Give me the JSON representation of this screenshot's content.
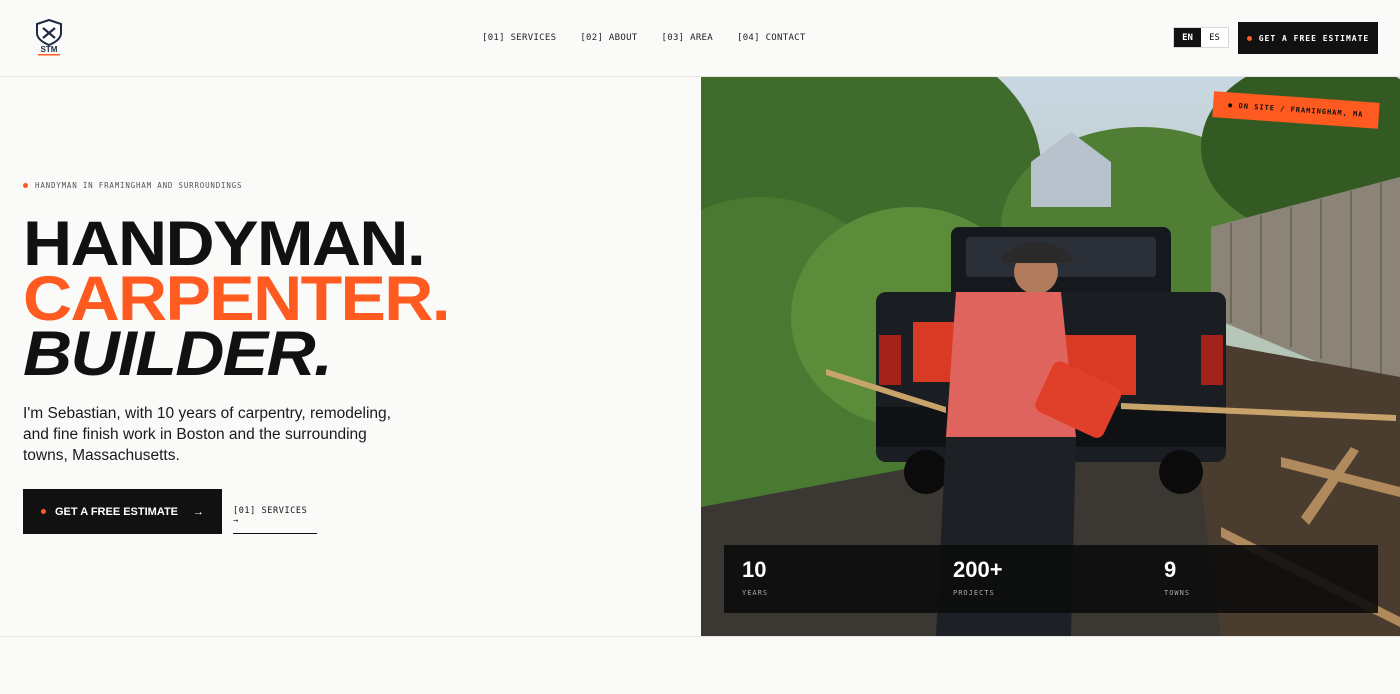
{
  "header": {
    "logo_text": "STM",
    "nav": [
      "[01] SERVICES",
      "[02] ABOUT",
      "[03] AREA",
      "[04] CONTACT"
    ],
    "lang_active": "EN",
    "lang_inactive": "ES",
    "cta_label": "GET A FREE ESTIMATE"
  },
  "hero": {
    "eyebrow": "HANDYMAN IN FRAMINGHAM AND SURROUNDINGS",
    "headline_1": "HANDYMAN.",
    "headline_2": "CARPENTER.",
    "headline_3": "BUILDER.",
    "lead": "I'm Sebastian, with 10 years of carpentry, remodeling, and fine finish work in Boston and the surrounding towns, Massachusetts.",
    "cta_label": "GET A FREE ESTIMATE",
    "cta_arrow": "→",
    "secondary_link": "[01] SERVICES →"
  },
  "photo": {
    "badge": "ON SITE / FRAMINGHAM, MA"
  },
  "stats": [
    {
      "num": "10",
      "label": "YEARS"
    },
    {
      "num": "200+",
      "label": "PROJECTS"
    },
    {
      "num": "9",
      "label": "TOWNS"
    }
  ],
  "colors": {
    "accent": "#ff5a1f",
    "ink": "#111111",
    "bg": "#fafaf8"
  }
}
